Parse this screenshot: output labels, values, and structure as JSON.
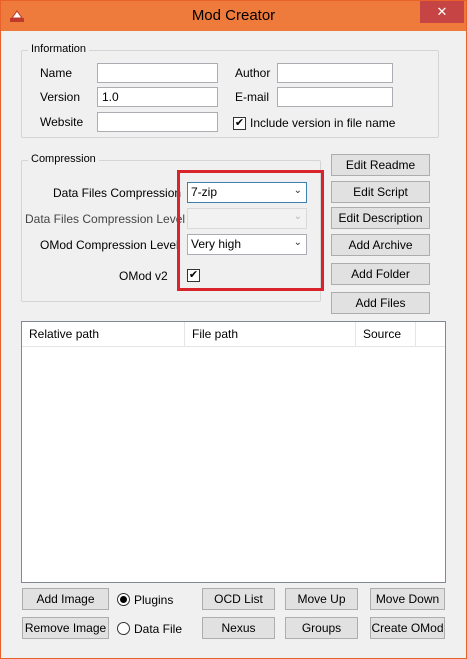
{
  "window": {
    "title": "Mod Creator",
    "close_glyph": "✕",
    "accent_color": "#ee7a3b"
  },
  "information": {
    "legend": "Information",
    "name_label": "Name",
    "name_value": "",
    "author_label": "Author",
    "author_value": "",
    "version_label": "Version",
    "version_value": "1.0",
    "email_label": "E-mail",
    "email_value": "",
    "website_label": "Website",
    "website_value": "",
    "include_version_label": "Include version in file name",
    "include_version_checked": true
  },
  "compression": {
    "legend": "Compression",
    "data_files_label": "Data Files Compression",
    "data_files_value": "7-zip",
    "data_files_level_label": "Data Files Compression Level",
    "data_files_level_value": "",
    "omod_level_label": "OMod Compression Level",
    "omod_level_value": "Very high",
    "omod_v2_label": "OMod v2",
    "omod_v2_checked": true
  },
  "side_buttons": {
    "edit_readme": "Edit Readme",
    "edit_script": "Edit Script",
    "edit_description": "Edit Description",
    "add_archive": "Add Archive",
    "add_folder": "Add Folder",
    "add_files": "Add Files"
  },
  "file_list": {
    "columns": [
      "Relative path",
      "File path",
      "Source"
    ],
    "rows": []
  },
  "bottom": {
    "add_image": "Add Image",
    "remove_image": "Remove Image",
    "plugins_label": "Plugins",
    "plugins_selected": true,
    "data_file_label": "Data File",
    "data_file_selected": false,
    "ocd_list": "OCD List",
    "nexus": "Nexus",
    "move_up": "Move Up",
    "groups": "Groups",
    "move_down": "Move Down",
    "create_omod": "Create OMod"
  },
  "icons": {
    "app": "mod-creator-icon",
    "check_glyph": "✔",
    "dropdown_glyph": "⌄"
  }
}
